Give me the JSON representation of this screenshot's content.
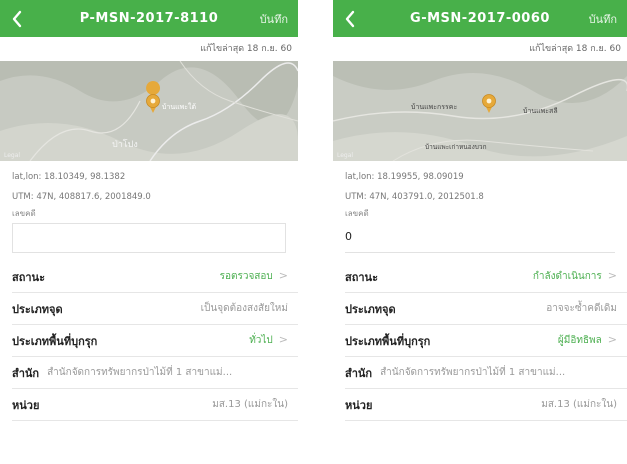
{
  "colors": {
    "header_green": "#48b04a",
    "value_green": "#4caf50",
    "pin": "#e6a93a"
  },
  "screens": [
    {
      "header": {
        "title": "P-MSN-2017-8110",
        "save_label": "บันทึก",
        "back_icon": "chevron-left-icon"
      },
      "updated": "แก้ไขล่าสุด 18 ก.ย. 60",
      "map": {
        "labels": [
          "บ้านแพะใต้",
          "ป่าโปง"
        ],
        "legal": "Legal"
      },
      "latlon": "lat,lon: 18.10349, 98.1382",
      "utm": "UTM: 47N, 408817.6, 2001849.0",
      "field_label": "เลขคดี",
      "field_value": "",
      "rows": [
        {
          "label": "สถานะ",
          "value": "รอตรวจสอบ",
          "chevron": ">"
        },
        {
          "label": "ประเภทจุด",
          "value": "เป็นจุดต้องสงสัยใหม่"
        },
        {
          "label": "ประเภทพื้นที่บุกรุก",
          "value": "ทั่วไป",
          "chevron": ">"
        },
        {
          "label": "สำนัก",
          "inline": "สำนักจัดการทรัพยากรป่าไม้ที่ 1 สาขาแม่..."
        },
        {
          "label": "หน่วย",
          "value": "มส.13 (แม่กะใน)"
        }
      ]
    },
    {
      "header": {
        "title": "G-MSN-2017-0060",
        "save_label": "บันทึก",
        "back_icon": "chevron-left-icon"
      },
      "updated": "แก้ไขล่าสุด 18 ก.ย. 60",
      "map": {
        "labels": [
          "บ้านแพะกรรคะ",
          "บ้านแพะสลี",
          "บ้านแพะเก่าหนองบวก"
        ],
        "legal": "Legal"
      },
      "latlon": "lat,lon: 18.19955, 98.09019",
      "utm": "UTM: 47N, 403791.0, 2012501.8",
      "field_label": "เลขคดี",
      "field_value": "0",
      "rows": [
        {
          "label": "สถานะ",
          "value": "กำลังดำเนินการ",
          "chevron": ">"
        },
        {
          "label": "ประเภทจุด",
          "value": "อาจจะซ้ำคดีเดิม"
        },
        {
          "label": "ประเภทพื้นที่บุกรุก",
          "value": "ผู้มีอิทธิพล",
          "chevron": ">"
        },
        {
          "label": "สำนัก",
          "inline": "สำนักจัดการทรัพยากรป่าไม้ที่ 1 สาขาแม่..."
        },
        {
          "label": "หน่วย",
          "value": "มส.13 (แม่กะใน)"
        }
      ]
    }
  ]
}
